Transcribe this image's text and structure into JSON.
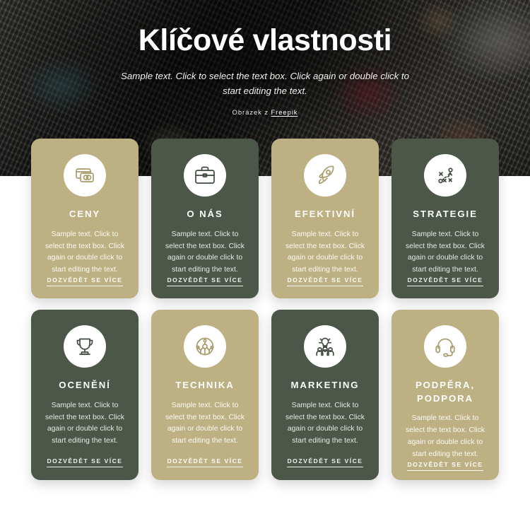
{
  "hero": {
    "title": "Klíčové vlastnosti",
    "subtitle": "Sample text. Click to select the text box. Click again or double click to start editing the text.",
    "credit_prefix": "Obrázek z ",
    "credit_link": "Freepik"
  },
  "colors": {
    "gold": "#bdb183",
    "green": "#4c5749",
    "card_title": "#fdfdfb",
    "page_background": "#ffffff"
  },
  "cards": [
    {
      "title": "CENY",
      "text": "Sample text. Click to select the text box. Click again or double click to start editing the text.",
      "link": "DOZVĚDĚT SE VÍCE",
      "icon": "credit-cards-icon",
      "theme": "gold",
      "row": 1
    },
    {
      "title": "O NÁS",
      "text": "Sample text. Click to select the text box. Click again or double click to start editing the text.",
      "link": "DOZVĚDĚT SE VÍCE",
      "icon": "briefcase-icon",
      "theme": "green",
      "row": 1
    },
    {
      "title": "EFEKTIVNÍ",
      "text": "Sample text. Click to select the text box. Click again or double click to start editing the text.",
      "link": "DOZVĚDĚT SE VÍCE",
      "icon": "rocket-icon",
      "theme": "gold",
      "row": 1
    },
    {
      "title": "STRATEGIE",
      "text": "Sample text. Click to select the text box. Click again or double click to start editing the text.",
      "link": "DOZVĚDĚT SE VÍCE",
      "icon": "strategy-playbook-icon",
      "theme": "green",
      "row": 1
    },
    {
      "title": "OCENĚNÍ",
      "text": "Sample text. Click to select the text box. Click again or double click to start editing the text.",
      "link": "DOZVĚDĚT SE VÍCE",
      "icon": "trophy-icon",
      "theme": "green",
      "row": 2
    },
    {
      "title": "TECHNIKA",
      "text": "Sample text. Click to select the text box. Click again or double click to start editing the text.",
      "link": "DOZVĚDĚT SE VÍCE",
      "icon": "circuit-icon",
      "theme": "gold",
      "row": 2
    },
    {
      "title": "MARKETING",
      "text": "Sample text. Click to select the text box. Click again or double click to start editing the text.",
      "link": "DOZVĚDĚT SE VÍCE",
      "icon": "lightbulb-people-icon",
      "theme": "green",
      "row": 2
    },
    {
      "title": "PODPĚRA, PODPORA",
      "text": "Sample text. Click to select the text box. Click again or double click to start editing the text.",
      "link": "DOZVĚDĚT SE VÍCE",
      "icon": "headset-icon",
      "theme": "gold",
      "row": 2
    }
  ]
}
